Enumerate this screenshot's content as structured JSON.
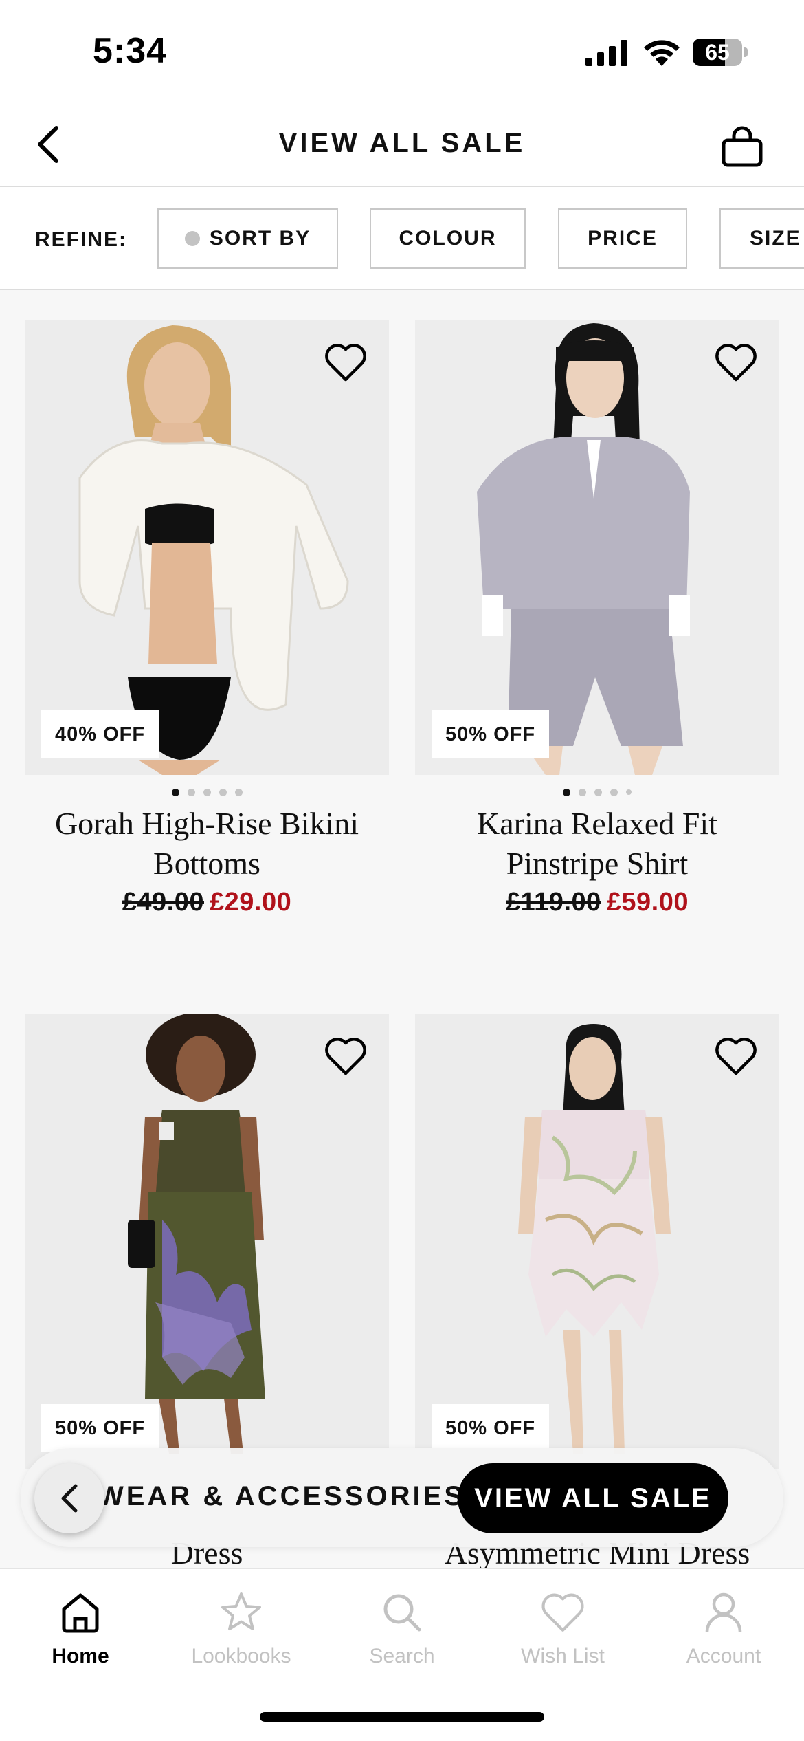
{
  "status_bar": {
    "time": "5:34",
    "battery": "65",
    "battery_level": 0.65
  },
  "header": {
    "title": "VIEW ALL SALE"
  },
  "refine": {
    "label": "REFINE:",
    "filters": [
      "SORT BY",
      "COLOUR",
      "PRICE",
      "SIZE"
    ]
  },
  "products": [
    {
      "discount": "40% OFF",
      "name_line1": "Gorah High-Rise Bikini",
      "name_line2": "Bottoms",
      "price_old": "£49.00",
      "price_new": "£29.00",
      "image_count": 5
    },
    {
      "discount": "50% OFF",
      "name_line1": "Karina Relaxed Fit",
      "name_line2": "Pinstripe Shirt",
      "price_old": "£119.00",
      "price_new": "£59.00",
      "image_count": 5
    },
    {
      "discount": "50% OFF",
      "name_partial": "Dress"
    },
    {
      "discount": "50% OFF",
      "name_partial": "Asymmetric Mini Dress"
    }
  ],
  "category_pills": {
    "previous": "WEAR & ACCESSORIES",
    "active": "VIEW ALL SALE"
  },
  "tab_bar": {
    "items": [
      {
        "label": "Home",
        "icon": "home-icon",
        "active": true
      },
      {
        "label": "Lookbooks",
        "icon": "star-icon",
        "active": false
      },
      {
        "label": "Search",
        "icon": "search-icon",
        "active": false
      },
      {
        "label": "Wish List",
        "icon": "heart-icon",
        "active": false
      },
      {
        "label": "Account",
        "icon": "person-icon",
        "active": false
      }
    ]
  },
  "colors": {
    "sale_red": "#b0121b",
    "active_pill": "#000000",
    "inactive_tab": "#c2c2c2"
  }
}
